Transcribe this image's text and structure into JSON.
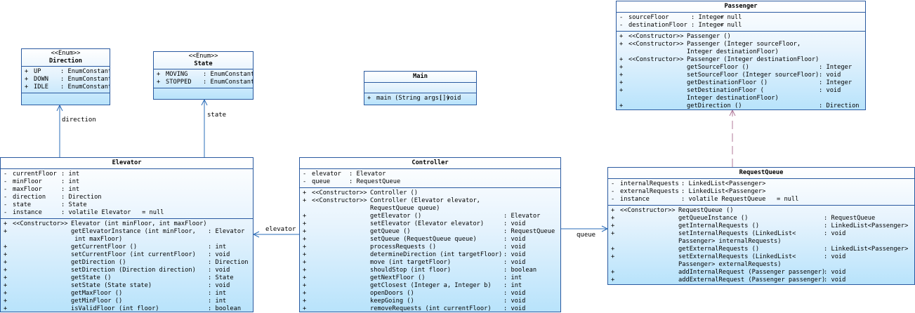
{
  "classes": {
    "direction": {
      "stereotype": "<<Enum>>",
      "name": "Direction",
      "attributes": [
        [
          "+",
          "UP",
          ": EnumConstant"
        ],
        [
          "+",
          "DOWN",
          ": EnumConstant"
        ],
        [
          "+",
          "IDLE",
          ": EnumConstant"
        ]
      ],
      "operations": []
    },
    "state": {
      "stereotype": "<<Enum>>",
      "name": "State",
      "attributes": [
        [
          "+",
          "MOVING",
          ": EnumConstant"
        ],
        [
          "+",
          "STOPPED",
          ": EnumConstant"
        ]
      ],
      "operations": []
    },
    "main": {
      "name": "Main",
      "attributes": [],
      "operations": [
        [
          "+",
          "main (String args[])",
          ": void"
        ]
      ]
    },
    "passenger": {
      "name": "Passenger",
      "attributes": [
        [
          "-",
          "sourceFloor",
          ": Integer",
          "= null"
        ],
        [
          "-",
          "destinationFloor",
          ": Integer",
          "= null"
        ]
      ],
      "operations": [
        [
          "+",
          "<<Constructor>>",
          "Passenger ()",
          ""
        ],
        [
          "+",
          "<<Constructor>>",
          "Passenger (Integer sourceFloor,",
          ""
        ],
        [
          "",
          "",
          "Integer destinationFloor)",
          ""
        ],
        [
          "+",
          "<<Constructor>>",
          "Passenger (Integer destinationFloor)",
          ""
        ],
        [
          "+",
          "",
          "getSourceFloor ()",
          ": Integer"
        ],
        [
          "+",
          "",
          "setSourceFloor (Integer sourceFloor)",
          ": void"
        ],
        [
          "+",
          "",
          "getDestinationFloor ()",
          ": Integer"
        ],
        [
          "+",
          "",
          "setDestinationFloor (",
          ": void"
        ],
        [
          "",
          "",
          "Integer destinationFloor)",
          ""
        ],
        [
          "+",
          "",
          "getDirection ()",
          ": Direction"
        ]
      ]
    },
    "elevator": {
      "name": "Elevator",
      "attributes": [
        [
          "-",
          "currentFloor",
          ": int"
        ],
        [
          "-",
          "minFloor",
          ": int"
        ],
        [
          "-",
          "maxFloor",
          ": int"
        ],
        [
          "-",
          "direction",
          ": Direction"
        ],
        [
          "-",
          "state",
          ": State"
        ],
        [
          "-",
          "instance",
          ": volatile Elevator   = null"
        ]
      ],
      "operations": [
        [
          "+",
          "<<Constructor>>",
          "Elevator (int minFloor, int maxFloor)",
          ""
        ],
        [
          "+",
          "",
          "getElevatorInstance (int minFloor,",
          ": Elevator"
        ],
        [
          "",
          "",
          " int maxFloor)",
          ""
        ],
        [
          "+",
          "",
          "getCurrentFloor ()",
          ": int"
        ],
        [
          "+",
          "",
          "setCurrentFloor (int currentFloor)",
          ": void"
        ],
        [
          "+",
          "",
          "getDirection ()",
          ": Direction"
        ],
        [
          "+",
          "",
          "setDirection (Direction direction)",
          ": void"
        ],
        [
          "+",
          "",
          "getState ()",
          ": State"
        ],
        [
          "+",
          "",
          "setState (State state)",
          ": void"
        ],
        [
          "+",
          "",
          "getMaxFloor ()",
          ": int"
        ],
        [
          "+",
          "",
          "getMinFloor ()",
          ": int"
        ],
        [
          "+",
          "",
          "isValidFloor (int floor)",
          ": boolean"
        ]
      ]
    },
    "controller": {
      "name": "Controller",
      "attributes": [
        [
          "-",
          "elevator",
          ": Elevator"
        ],
        [
          "-",
          "queue",
          ": RequestQueue"
        ]
      ],
      "operations": [
        [
          "+",
          "<<Constructor>>",
          "Controller ()",
          ""
        ],
        [
          "+",
          "<<Constructor>>",
          "Controller (Elevator elevator,",
          ""
        ],
        [
          "",
          "",
          "RequestQueue queue)",
          ""
        ],
        [
          "+",
          "",
          "getElevator ()",
          ": Elevator"
        ],
        [
          "+",
          "",
          "setElevator (Elevator elevator)",
          ": void"
        ],
        [
          "+",
          "",
          "getQueue ()",
          ": RequestQueue"
        ],
        [
          "+",
          "",
          "setQueue (RequestQueue queue)",
          ": void"
        ],
        [
          "+",
          "",
          "processRequests ()",
          ": void"
        ],
        [
          "+",
          "",
          "determineDirection (int targetFloor)",
          ": void"
        ],
        [
          "+",
          "",
          "move (int targetFloor)",
          ": void"
        ],
        [
          "+",
          "",
          "shouldStop (int floor)",
          ": boolean"
        ],
        [
          "+",
          "",
          "getNextFloor ()",
          ": int"
        ],
        [
          "+",
          "",
          "getClosest (Integer a, Integer b)",
          ": int"
        ],
        [
          "+",
          "",
          "openDoors ()",
          ": void"
        ],
        [
          "+",
          "",
          "keepGoing ()",
          ": void"
        ],
        [
          "+",
          "",
          "removeRequests (int currentFloor)",
          ": void"
        ]
      ]
    },
    "requestqueue": {
      "name": "RequestQueue",
      "attributes": [
        [
          "-",
          "internalRequests",
          ": LinkedList<Passenger>"
        ],
        [
          "-",
          "externalRequests",
          ": LinkedList<Passenger>"
        ],
        [
          "-",
          "instance",
          ": volatile RequestQueue   = null"
        ]
      ],
      "operations": [
        [
          "+",
          "<<Constructor>>",
          "RequestQueue ()",
          ""
        ],
        [
          "+",
          "",
          "getQueueInstance ()",
          ": RequestQueue"
        ],
        [
          "+",
          "",
          "getInternalRequests ()",
          ": LinkedList<Passenger>"
        ],
        [
          "+",
          "",
          "setInternalRequests (LinkedList<",
          ": void"
        ],
        [
          "",
          "",
          "Passenger> internalRequests)",
          ""
        ],
        [
          "+",
          "",
          "getExternalRequests ()",
          ": LinkedList<Passenger>"
        ],
        [
          "+",
          "",
          "setExternalRequests (LinkedList<",
          ": void"
        ],
        [
          "",
          "",
          "Passenger> externalRequests)",
          ""
        ],
        [
          "+",
          "",
          "addInternalRequest (Passenger passenger)",
          ": void"
        ],
        [
          "+",
          "",
          "addExternalRequest (Passenger passenger)",
          ": void"
        ]
      ]
    }
  },
  "associations": {
    "elevator_direction": "direction",
    "elevator_state": "state",
    "controller_elevator": "elevator",
    "controller_queue": "queue"
  },
  "colors": {
    "border": "#2a5aa0",
    "line": "#2a6cb8",
    "fill_top": "#ffffff",
    "fill_bottom": "#b8e3fb",
    "dependency": "#b07a9a"
  }
}
